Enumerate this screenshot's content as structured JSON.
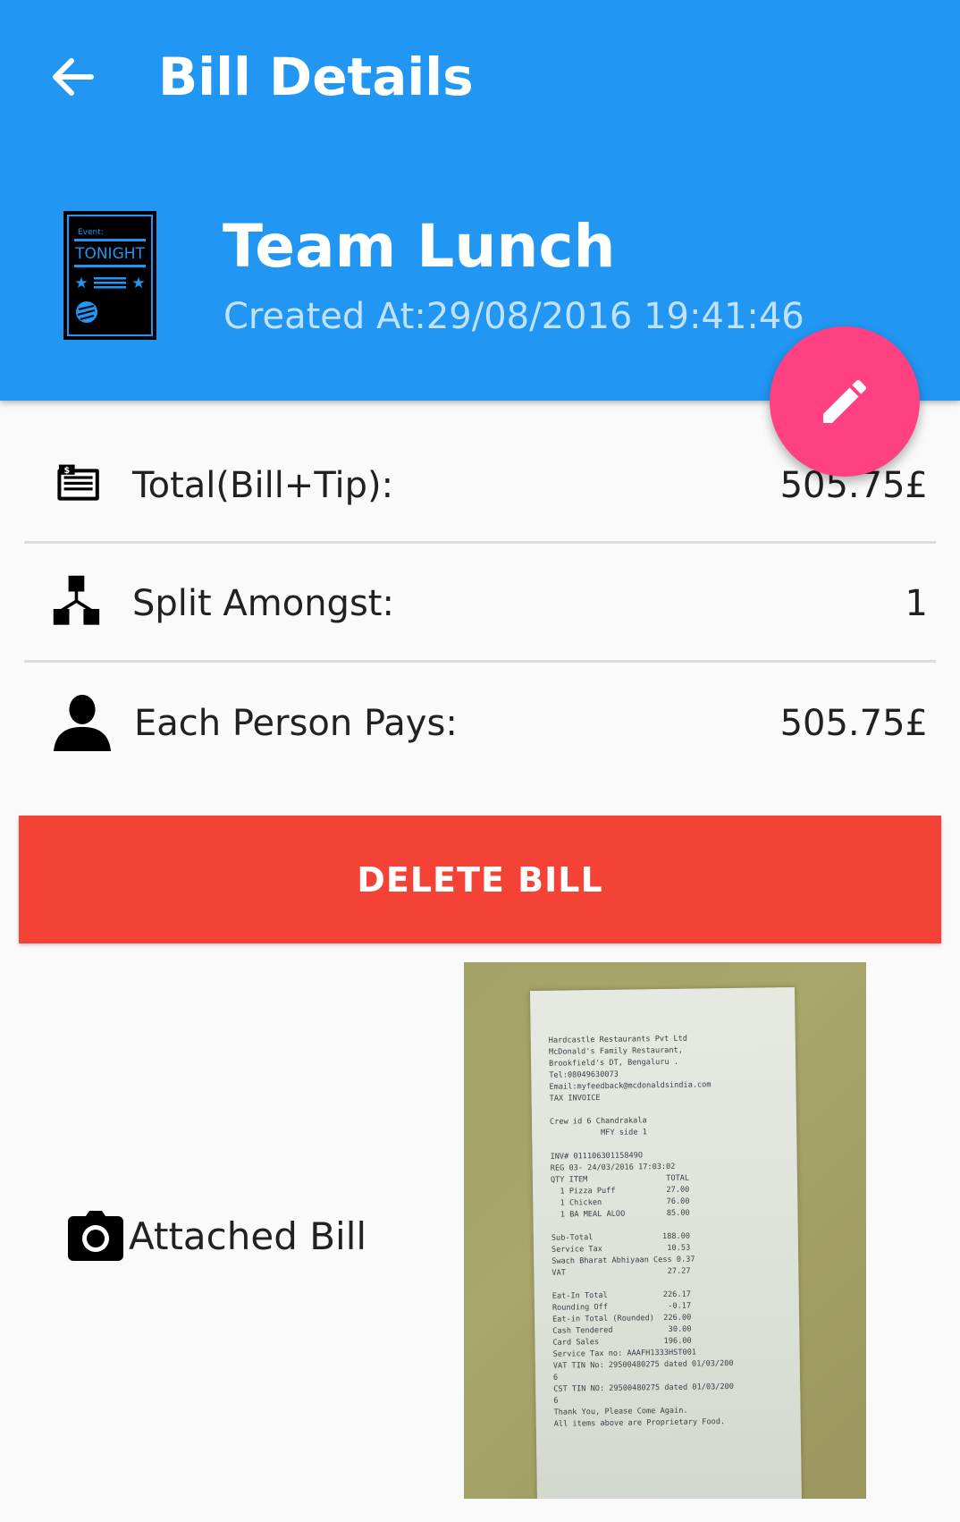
{
  "toolbar": {
    "title": "Bill Details"
  },
  "header": {
    "bill_name": "Team Lunch",
    "created_at": "Created At:29/08/2016 19:41:46",
    "event_icon_text": "Event:",
    "event_icon_tonight": "TONIGHT"
  },
  "details": {
    "total_label": "Total(Bill+Tip):",
    "total_value": "505.75£",
    "split_label": "Split Amongst:",
    "split_value": "1",
    "each_label": "Each Person Pays:",
    "each_value": "505.75£"
  },
  "actions": {
    "delete_label": "DELETE BILL"
  },
  "attachment": {
    "label": "Attached Bill",
    "receipt_lines": [
      "Hardcastle Restaurants Pvt Ltd",
      "McDonald's Family Restaurant,",
      "Brookfield's DT, Bengaluru .",
      "Tel:08049630073",
      "Email:myfeedback@mcdonaldsindia.com",
      "TAX INVOICE",
      "",
      "Crew id 6 Chandrakala",
      "           MFY side 1",
      "",
      "INV# 01110630115849O",
      "REG 03- 24/03/2016 17:03:02",
      "QTY ITEM                 TOTAL",
      "  1 Pizza Puff           27.00",
      "  1 Chicken              76.00",
      "  1 BA MEAL ALOO         85.00",
      "",
      "Sub-Total               188.00",
      "Service Tax              10.53",
      "Swach Bharat Abhiyaan Cess 0.37",
      "VAT                      27.27",
      "",
      "Eat-In Total            226.17",
      "Rounding Off             -0.17",
      "Eat-in Total (Rounded)  226.00",
      "Cash Tendered            30.00",
      "Card Sales              196.00",
      "Service Tax no: AAAFH1333HST001",
      "VAT TIN No: 29500480275 dated 01/03/200",
      "6",
      "CST TIN NO: 29500480275 dated 01/03/200",
      "6",
      "Thank You, Please Come Again.",
      "All items above are Proprietary Food."
    ]
  },
  "colors": {
    "primary": "#2196F3",
    "accent": "#FF4081",
    "danger": "#F44336"
  },
  "icons": {
    "back": "arrow-left-icon",
    "fab": "pencil-icon",
    "total": "receipt-icon",
    "split": "hierarchy-icon",
    "each": "person-icon",
    "attachment": "camera-icon"
  }
}
